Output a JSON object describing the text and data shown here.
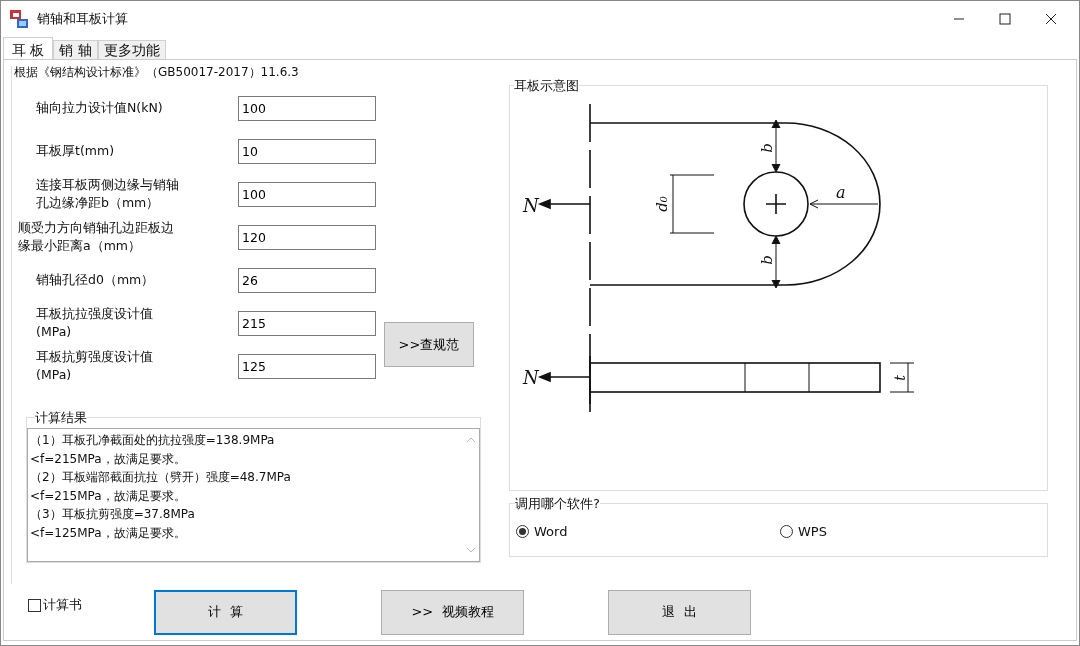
{
  "window": {
    "title": "销轴和耳板计算"
  },
  "tabs": [
    {
      "label": "耳 板",
      "selected": true
    },
    {
      "label": "销  轴",
      "selected": false
    },
    {
      "label": "更多功能",
      "selected": false
    }
  ],
  "standard_group": {
    "title": "根据《钢结构设计标准》（GB50017-2017）11.6.3"
  },
  "fields": [
    {
      "label": "轴向拉力设计值N(kN)",
      "value": "100"
    },
    {
      "label": "耳板厚t(mm)",
      "value": "10"
    },
    {
      "label": "连接耳板两侧边缘与销轴孔边缘净距b（mm）",
      "value": "100"
    },
    {
      "label": " 顺受力方向销轴孔边距板边缘最小距离a（mm）",
      "value": "120",
      "kind": "outdent"
    },
    {
      "label": "销轴孔径d0（mm）",
      "value": "26"
    },
    {
      "label": "耳板抗拉强度设计值",
      "unit": "(MPa)",
      "value": "215"
    },
    {
      "label": "耳板抗剪强度设计值",
      "unit": "(MPa)",
      "value": "125"
    }
  ],
  "code_button": {
    "label": ">>查规范"
  },
  "results": {
    "title": "计算结果",
    "lines": [
      "（1）耳板孔净截面处的抗拉强度=138.9MPa",
      "<f=215MPa，故满足要求。",
      "（2）耳板端部截面抗拉（劈开）强度=48.7MPa",
      "<f=215MPa，故满足要求。",
      "（3）耳板抗剪强度=37.8MPa",
      "<f=125MPa，故满足要求。"
    ]
  },
  "diagram": {
    "title": "耳板示意图",
    "labels": {
      "force_top": "N",
      "force_bottom": "N",
      "edge_top": "b",
      "edge_bottom": "b",
      "end": "a",
      "hole": "d₀",
      "thickness": "t"
    }
  },
  "software": {
    "title": "调用哪个软件?",
    "options": [
      {
        "label": "Word",
        "selected": true
      },
      {
        "label": "WPS",
        "selected": false
      }
    ]
  },
  "report_checkbox": {
    "label": "计算书",
    "checked": false
  },
  "buttons": [
    {
      "label": "计  算",
      "kind": "primary"
    },
    {
      "label": ">>  视频教程",
      "kind": "normal"
    },
    {
      "label": "退  出",
      "kind": "normal"
    }
  ]
}
